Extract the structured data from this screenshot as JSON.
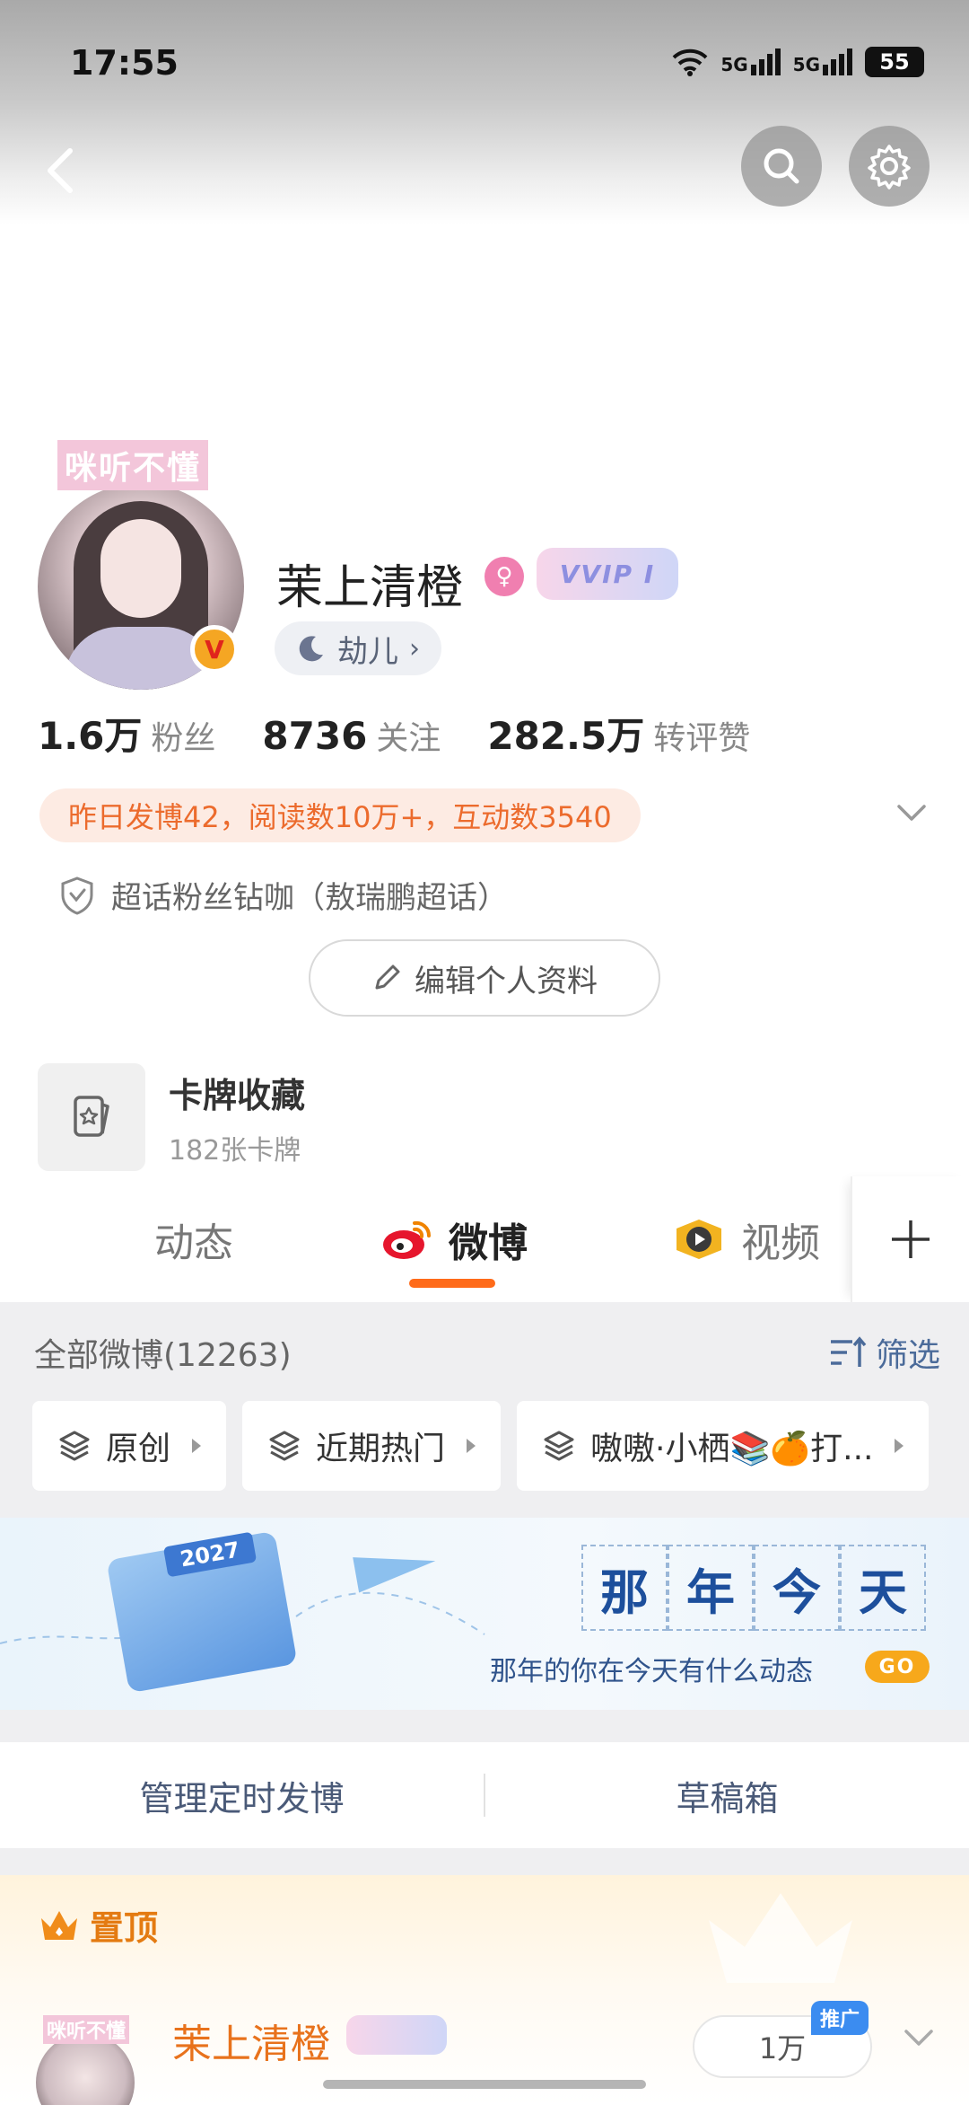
{
  "status_bar": {
    "time": "17:55",
    "network1": "5G",
    "network2": "5G",
    "battery": "55"
  },
  "nav": {
    "back": "back",
    "search": "search",
    "settings": "settings"
  },
  "profile": {
    "avatar_tag": "咪听不懂",
    "verified_badge": "V",
    "name": "茉上清橙",
    "vip_label": "VVIP I",
    "level": "劫儿",
    "stats": [
      {
        "value": "1.6万",
        "label": "粉丝"
      },
      {
        "value": "8736",
        "label": "关注"
      },
      {
        "value": "282.5万",
        "label": "转评赞"
      }
    ],
    "activity": "昨日发博42，阅读数10万+，互动数3540",
    "supertopic": "超话粉丝钻咖（敖瑞鹏超话）",
    "edit_button": "编辑个人资料"
  },
  "cards": {
    "title": "卡牌收藏",
    "subtitle": "182张卡牌"
  },
  "tabs": [
    {
      "label": "动态"
    },
    {
      "label": "微博"
    },
    {
      "label": "视频"
    }
  ],
  "feed": {
    "all_title": "全部微博(12263)",
    "filter": "筛选",
    "chips": [
      "原创",
      "近期热门",
      "嗷嗷·小栖📚🍊打..."
    ]
  },
  "banner": {
    "calendar_year": "2027",
    "title_chars": [
      "那",
      "年",
      "今",
      "天"
    ],
    "subtitle": "那年的你在今天有什么动态",
    "go": "GO"
  },
  "manage": {
    "scheduled": "管理定时发博",
    "drafts": "草稿箱"
  },
  "pinned": {
    "label": "置顶",
    "avatar_tag": "咪听不懂",
    "name": "茉上清橙",
    "count": "1万",
    "promo": "推广"
  },
  "colors": {
    "accent": "#ff6b1a",
    "link": "#4b6b9a",
    "pinned": "#e47b12"
  }
}
